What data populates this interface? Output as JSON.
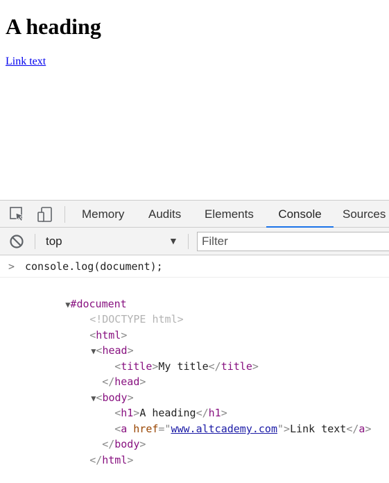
{
  "page": {
    "heading": "A heading",
    "link_text": "Link text"
  },
  "devtools": {
    "tabs": [
      {
        "label": "Memory",
        "active": false
      },
      {
        "label": "Audits",
        "active": false
      },
      {
        "label": "Elements",
        "active": false
      },
      {
        "label": "Console",
        "active": true
      },
      {
        "label": "Sources",
        "active": false
      }
    ],
    "toolbar": {
      "context": "top",
      "filter_placeholder": "Filter"
    },
    "console": {
      "prompt": ">",
      "command": "console.log(document);",
      "tree": {
        "root": "#document",
        "doctype": "<!DOCTYPE html>",
        "html_open": "html",
        "head_open": "head",
        "title_tag": "title",
        "title_text": "My title",
        "head_close": "head",
        "body_open": "body",
        "h1_tag": "h1",
        "h1_text": "A heading",
        "a_tag": "a",
        "a_attr_name": "href",
        "a_attr_value": "www.altcademy.com",
        "a_text": "Link text",
        "body_close": "body",
        "html_close": "html"
      }
    },
    "colors": {
      "active_tab_underline": "#1a73e8",
      "tag": "#881280",
      "attr_name": "#994500",
      "attr_value": "#1a1aa6"
    }
  }
}
